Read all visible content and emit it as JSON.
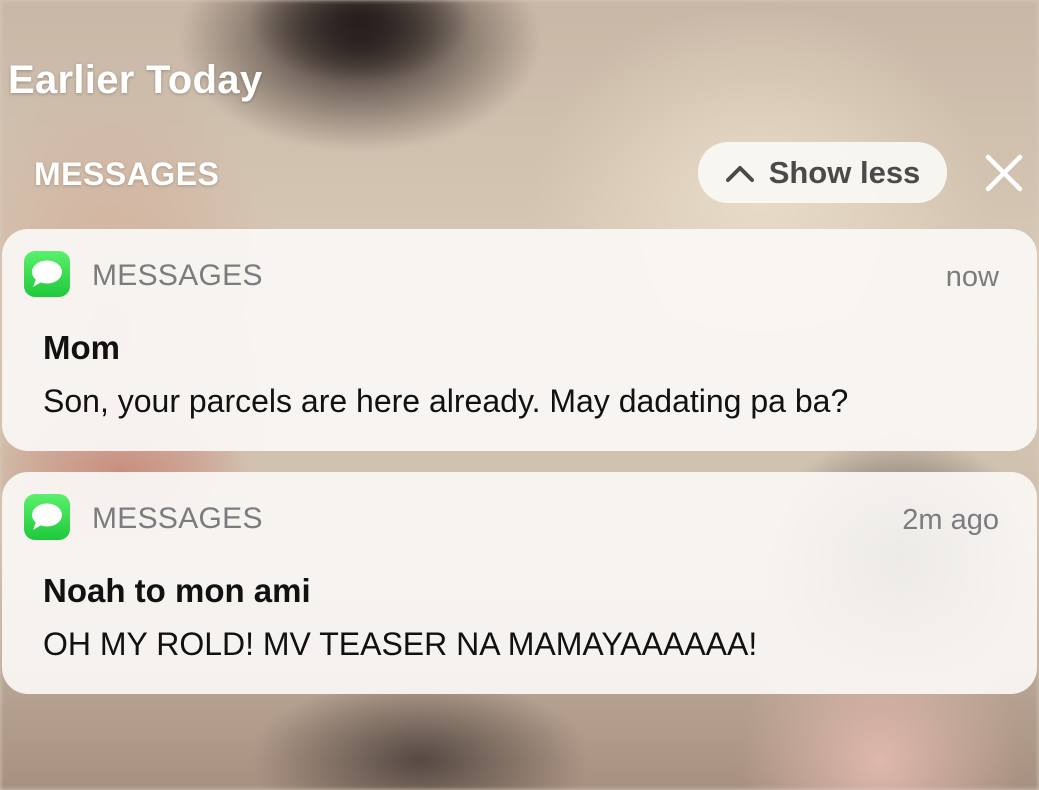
{
  "header": {
    "title": "Earlier Today"
  },
  "group": {
    "label": "MESSAGES",
    "show_less_label": "Show less",
    "show_less_icon": "chevron-up-icon",
    "close_icon": "close-icon"
  },
  "notifications": [
    {
      "app_icon": "messages-app-icon",
      "app_name": "MESSAGES",
      "time": "now",
      "sender": "Mom",
      "body": "Son, your parcels are here already. May dadating pa ba?"
    },
    {
      "app_icon": "messages-app-icon",
      "app_name": "MESSAGES",
      "time": "2m ago",
      "sender": "Noah to mon ami",
      "body": "OH MY ROLD! MV TEASER NA MAMAYAAAAAA!"
    }
  ],
  "colors": {
    "card_background": "#faf8f5",
    "messages_green": "#28d142",
    "secondary_text": "#7c7c80",
    "primary_text": "#111111"
  }
}
